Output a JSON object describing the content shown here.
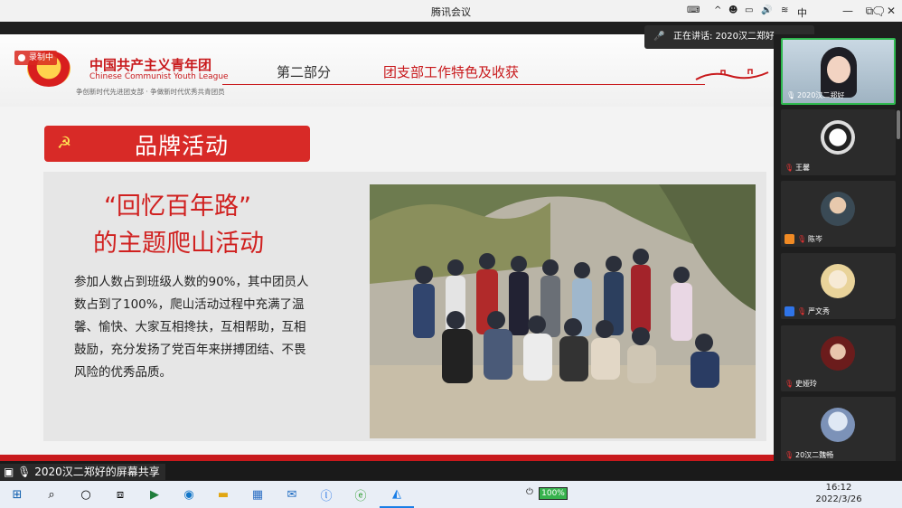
{
  "window": {
    "title": "腾讯会议",
    "minimize": "—",
    "restore": "⧉",
    "close": "✕"
  },
  "recording": {
    "label": "录制中"
  },
  "speaking": {
    "text": "正在讲话: 2020汉二郑好"
  },
  "slide": {
    "org_cn": "中国共产主义青年团",
    "org_en": "Chinese Communist Youth League",
    "motto": "争创新时代先进团支部 · 争做新时代优秀共青团员",
    "part": "第二部分",
    "part_title": "团支部工作特色及收获",
    "brand_label": "品牌活动",
    "heading_line1": "“回忆百年路”",
    "heading_line2": "的主题爬山活动",
    "paragraph": "参加人数占到班级人数的90%，其中团员人数占到了100%，爬山活动过程中充满了温馨、愉快、大家互相搀扶，互相帮助，互相鼓励，充分发扬了党百年来拼搏团结、不畏风险的优秀品质。"
  },
  "participants": [
    {
      "name": "2020汉二郑好",
      "active": true,
      "mic": "on"
    },
    {
      "name": "王馨",
      "mic": "muted"
    },
    {
      "name": "陈岑",
      "mic": "muted",
      "badge": "person"
    },
    {
      "name": "严文秀",
      "mic": "muted",
      "badge": "person-blue"
    },
    {
      "name": "史娅玲",
      "mic": "muted"
    },
    {
      "name": "20汉二魏畅",
      "mic": "muted"
    }
  ],
  "share_label": "2020汉二郑好的屏幕共享",
  "taskbar": {
    "battery": "100%",
    "ime": "中",
    "time": "16:12",
    "date": "2022/3/26"
  }
}
